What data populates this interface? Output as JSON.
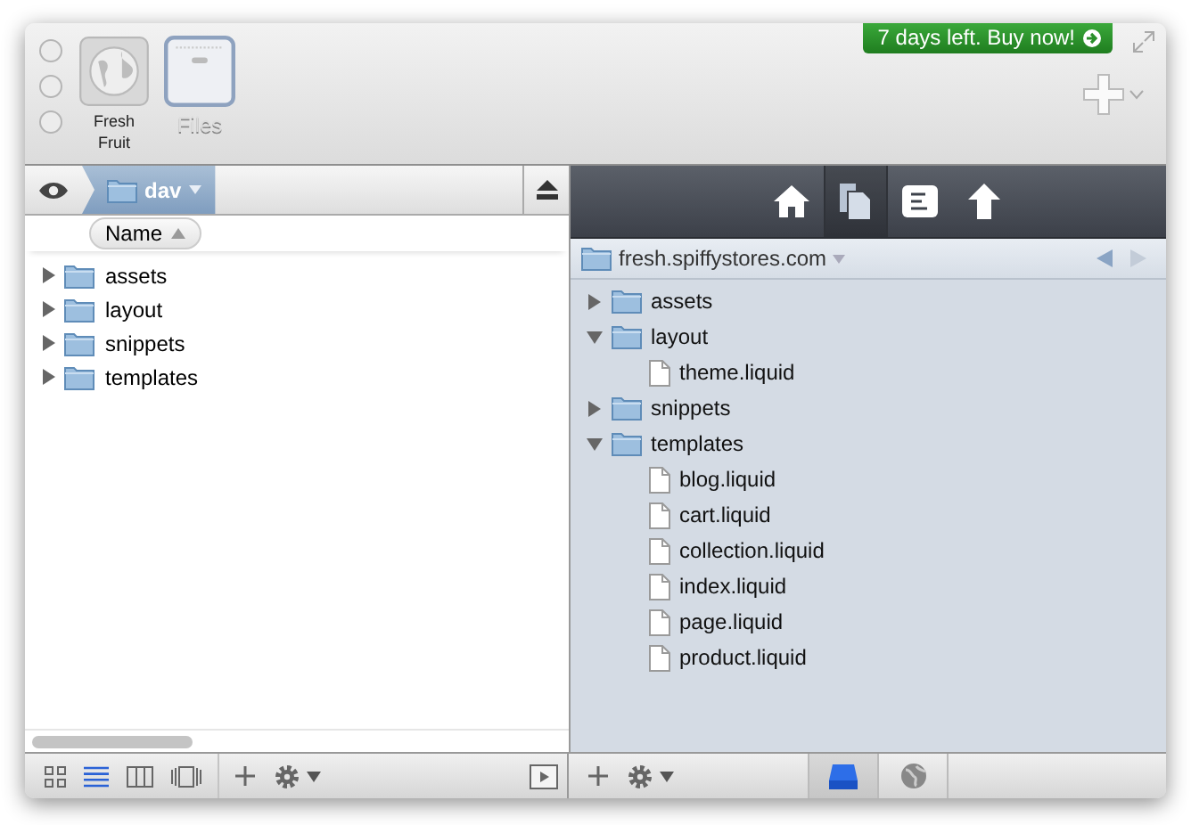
{
  "toolbar": {
    "favorites": [
      {
        "label": "Fresh Fruit",
        "kind": "site",
        "selected": false
      },
      {
        "label": "Files",
        "kind": "files",
        "selected": true
      }
    ],
    "promo": "7 days left. Buy now!"
  },
  "left_pane": {
    "path": "dav",
    "column": "Name",
    "items": [
      {
        "name": "assets",
        "expanded": false
      },
      {
        "name": "layout",
        "expanded": false
      },
      {
        "name": "snippets",
        "expanded": false
      },
      {
        "name": "templates",
        "expanded": false
      }
    ]
  },
  "right_pane": {
    "tabs": [
      {
        "kind": "home",
        "selected": false
      },
      {
        "kind": "files",
        "selected": true
      },
      {
        "kind": "document",
        "selected": false
      },
      {
        "kind": "upload",
        "selected": false
      }
    ],
    "path": "fresh.spiffystores.com",
    "tree": [
      {
        "name": "assets",
        "kind": "folder",
        "expanded": false
      },
      {
        "name": "layout",
        "kind": "folder",
        "expanded": true,
        "children": [
          {
            "name": "theme.liquid",
            "kind": "file"
          }
        ]
      },
      {
        "name": "snippets",
        "kind": "folder",
        "expanded": false
      },
      {
        "name": "templates",
        "kind": "folder",
        "expanded": true,
        "children": [
          {
            "name": "blog.liquid",
            "kind": "file"
          },
          {
            "name": "cart.liquid",
            "kind": "file"
          },
          {
            "name": "collection.liquid",
            "kind": "file"
          },
          {
            "name": "index.liquid",
            "kind": "file"
          },
          {
            "name": "page.liquid",
            "kind": "file"
          },
          {
            "name": "product.liquid",
            "kind": "file"
          }
        ]
      }
    ]
  },
  "left_bar": {
    "view_modes": [
      {
        "kind": "icons",
        "selected": false
      },
      {
        "kind": "list",
        "selected": true
      },
      {
        "kind": "columns",
        "selected": false
      },
      {
        "kind": "coverflow",
        "selected": false
      }
    ]
  },
  "right_bar": {
    "locations": [
      {
        "kind": "disk",
        "selected": true
      },
      {
        "kind": "globe",
        "selected": false
      }
    ]
  }
}
